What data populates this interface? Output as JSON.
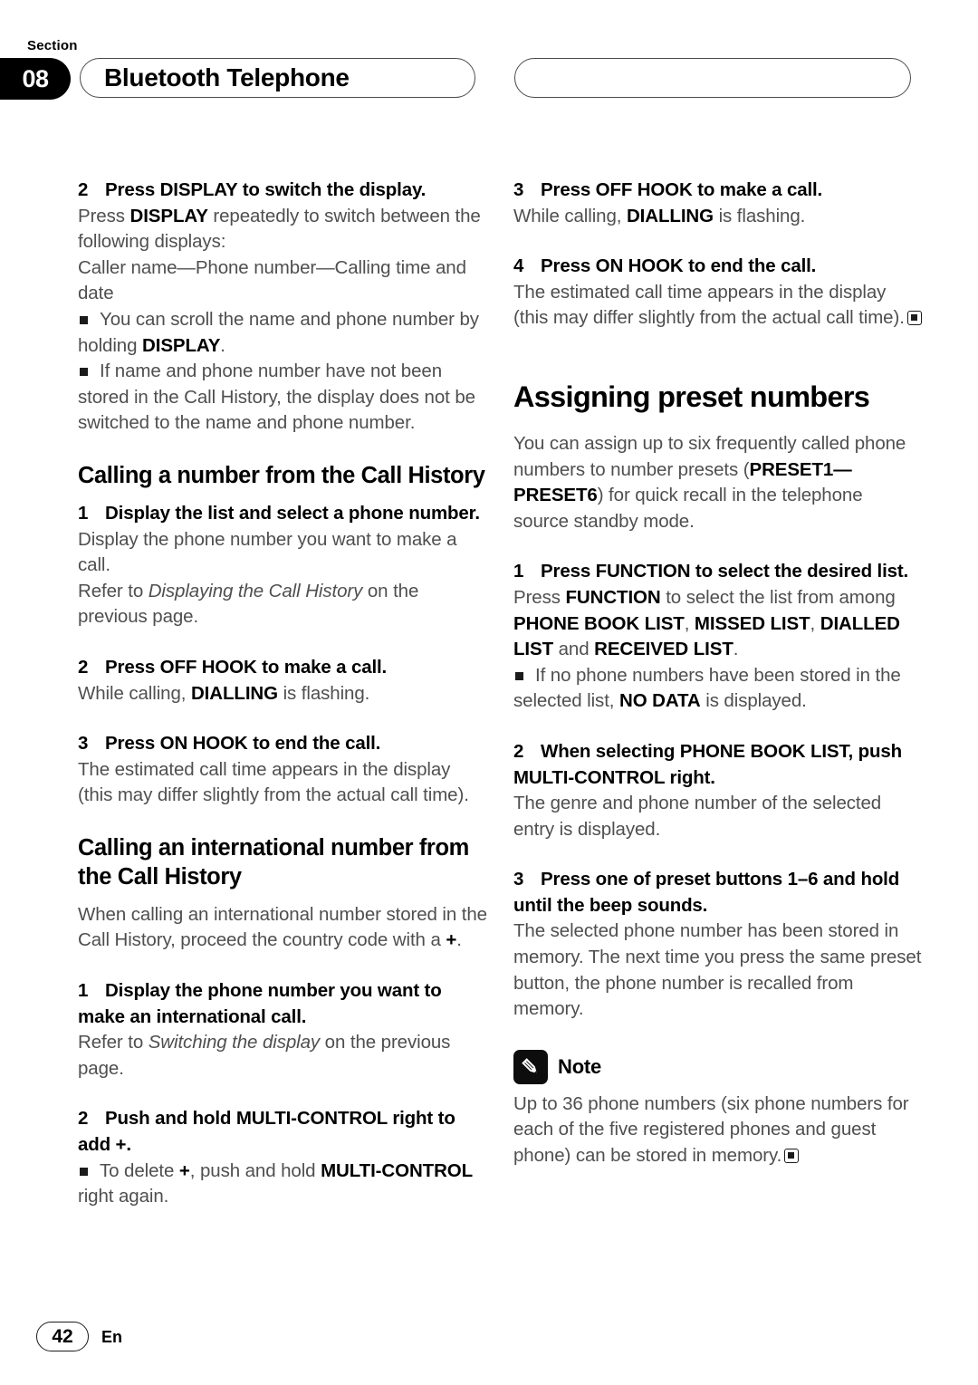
{
  "header": {
    "section_label": "Section",
    "section_number": "08",
    "title": "Bluetooth Telephone",
    "right_pill_text": ""
  },
  "left_column": {
    "step2_display": {
      "number": "2",
      "title": "Press DISPLAY to switch the display.",
      "body_1_pre": "Press ",
      "body_1_bold": "DISPLAY",
      "body_1_post": " repeatedly to switch between the following displays:",
      "body_2": "Caller name—Phone number—Calling time and date",
      "bullet_1_pre": "You can scroll the name and phone number by holding ",
      "bullet_1_bold": "DISPLAY",
      "bullet_1_post": ".",
      "bullet_2": "If name and phone number have not been stored in the Call History, the display does not be switched to the name and phone number."
    },
    "heading_call_history": "Calling a number from the Call History",
    "step1_display_list": {
      "number": "1",
      "title": "Display the list and select a phone number.",
      "body_1": "Display the phone number you want to make a call.",
      "body_2_pre": "Refer to ",
      "body_2_italic": "Displaying the Call History",
      "body_2_post": " on the previous page."
    },
    "step2_off_hook": {
      "number": "2",
      "title": "Press OFF HOOK to make a call.",
      "body_pre": "While calling, ",
      "body_bold": "DIALLING",
      "body_post": " is flashing."
    },
    "step3_on_hook": {
      "number": "3",
      "title": "Press ON HOOK to end the call.",
      "body": "The estimated call time appears in the display (this may differ slightly from the actual call time)."
    },
    "heading_international": "Calling an international number from the Call History",
    "international_intro_pre": "When calling an international number stored in the Call History, proceed the country code with a ",
    "international_intro_bold": "+",
    "international_intro_post": ".",
    "step1_international": {
      "number": "1",
      "title": "Display the phone number you want to make an international call.",
      "body_pre": "Refer to ",
      "body_italic": "Switching the display",
      "body_post": " on the previous page."
    },
    "step2_international": {
      "number": "2",
      "title": "Push and hold MULTI-CONTROL right to add +.",
      "bullet_pre": "To delete ",
      "bullet_bold_1": "+",
      "bullet_mid": ", push and hold ",
      "bullet_bold_2": "MULTI-CONTROL",
      "bullet_post": " right again."
    }
  },
  "right_column": {
    "step3_off_hook": {
      "number": "3",
      "title": "Press OFF HOOK to make a call.",
      "body_pre": "While calling, ",
      "body_bold": "DIALLING",
      "body_post": " is flashing."
    },
    "step4_on_hook": {
      "number": "4",
      "title": "Press ON HOOK to end the call.",
      "body": "The estimated call time appears in the display (this may differ slightly from the actual call time)."
    },
    "heading_assigning": "Assigning preset numbers",
    "assigning_intro_pre": "You can assign up to six frequently called phone numbers to number presets (",
    "assigning_intro_bold": "PRESET1—PRESET6",
    "assigning_intro_post": ") for quick recall in the telephone source standby mode.",
    "step1_function": {
      "number": "1",
      "title": "Press FUNCTION to select the desired list.",
      "body_pre": "Press ",
      "body_bold_1": "FUNCTION",
      "body_mid_1": " to select the list from among ",
      "body_bold_2": "PHONE BOOK LIST",
      "body_mid_2": ", ",
      "body_bold_3": "MISSED LIST",
      "body_mid_3": ", ",
      "body_bold_4": "DIALLED LIST",
      "body_mid_4": " and ",
      "body_bold_5": "RECEIVED LIST",
      "body_post": ".",
      "bullet_pre": "If no phone numbers have been stored in the selected list, ",
      "bullet_bold": "NO DATA",
      "bullet_post": " is displayed."
    },
    "step2_phone_book": {
      "number": "2",
      "title": "When selecting PHONE BOOK LIST, push MULTI-CONTROL right.",
      "body": "The genre and phone number of the selected entry is displayed."
    },
    "step3_preset": {
      "number": "3",
      "title": "Press one of preset buttons 1–6 and hold until the beep sounds.",
      "body": "The selected phone number has been stored in memory. The next time you press the same preset button, the phone number is recalled from memory."
    },
    "note": {
      "label": "Note",
      "body": "Up to 36 phone numbers (six phone numbers for each of the five registered phones and guest phone) can be stored in memory."
    }
  },
  "footer": {
    "page_number": "42",
    "language": "En"
  }
}
